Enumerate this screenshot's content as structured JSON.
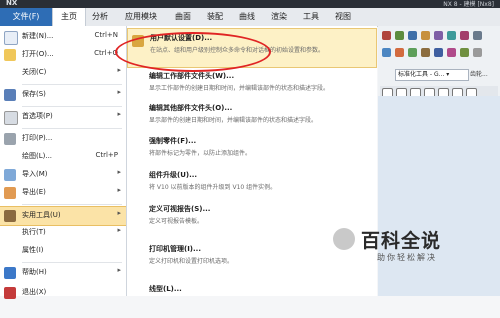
{
  "app": {
    "logo": "NX",
    "title": "NX 8 - 建模 [Nx8]"
  },
  "tabs": [
    "文件(F)",
    "主页",
    "分析",
    "应用模块",
    "曲面",
    "装配",
    "曲线",
    "渲染",
    "工具",
    "视图"
  ],
  "left_menu": [
    {
      "label": "新建(N)...",
      "shortcut": "Ctrl+N"
    },
    {
      "label": "打开(O)...",
      "shortcut": "Ctrl+O"
    },
    {
      "label": "关闭(C)",
      "shortcut": ""
    },
    {
      "label": "保存(S)",
      "shortcut": ""
    },
    {
      "label": "首选项(P)",
      "shortcut": ""
    },
    {
      "label": "打印(P)...",
      "shortcut": ""
    },
    {
      "label": "绘图(L)...",
      "shortcut": "Ctrl+P"
    },
    {
      "label": "导入(M)",
      "shortcut": ""
    },
    {
      "label": "导出(E)",
      "shortcut": ""
    },
    {
      "label": "实用工具(U)",
      "shortcut": ""
    },
    {
      "label": "执行(T)",
      "shortcut": ""
    },
    {
      "label": "属性(I)",
      "shortcut": ""
    },
    {
      "label": "帮助(H)",
      "shortcut": ""
    },
    {
      "label": "退出(X)",
      "shortcut": ""
    }
  ],
  "right_menu": [
    {
      "title": "用户默认设置(D)...",
      "desc": "在站点、组和用户级别控制众多命令和对话框的初始设置和参数。"
    },
    {
      "title": "编辑工作部件文件头(W)...",
      "desc": "显示工作部件的创建日期和时间，并编辑该部件的状态和描述字段。"
    },
    {
      "title": "编辑其他部件文件头(O)...",
      "desc": "显示部件的创建日期和时间，并编辑该部件的状态和描述字段。"
    },
    {
      "title": "强制零件(F)...",
      "desc": "将部件标记为零件，以防止添加组件。"
    },
    {
      "title": "组件升级(U)...",
      "desc": "将 V10 以前版本的组件升级到 V10 组件实例。"
    },
    {
      "title": "定义可视报告(S)...",
      "desc": "定义可视报告模板。"
    },
    {
      "title": "打印机管理(I)...",
      "desc": "定义打印机和设置打印机选项。"
    },
    {
      "title": "线型(L)...",
      "desc": ""
    }
  ],
  "ribbon": {
    "dropdown": "标准化工具 - G... ▾",
    "group_label": "齿轮..."
  },
  "watermark": {
    "big": "百科全说",
    "small": "助你轻松解决"
  },
  "colors": {
    "accent": "#2e6db5",
    "highlight": "#fbe3a7",
    "annotation": "#e02424"
  }
}
